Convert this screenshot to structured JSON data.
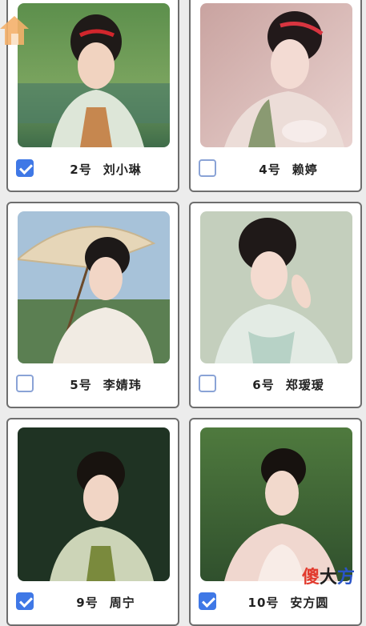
{
  "cards": [
    {
      "number": "2号",
      "name": "刘小琳",
      "checked": true
    },
    {
      "number": "4号",
      "name": "赖婷",
      "checked": false
    },
    {
      "number": "5号",
      "name": "李婧玮",
      "checked": false
    },
    {
      "number": "6号",
      "name": "郑瑷瑷",
      "checked": false
    },
    {
      "number": "9号",
      "name": "周宁",
      "checked": true
    },
    {
      "number": "10号",
      "name": "安方圆",
      "checked": true
    }
  ],
  "watermark": {
    "part1": "傻",
    "part2": "大",
    "part3": "方"
  },
  "colors": {
    "accent": "#3f78e6",
    "home_icon": "#f4b06a"
  }
}
